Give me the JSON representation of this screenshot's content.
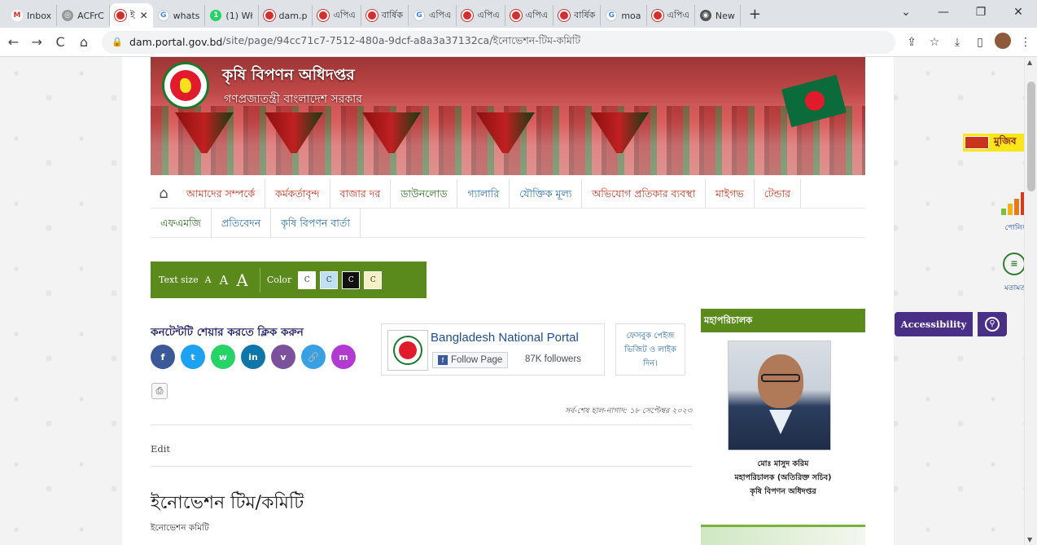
{
  "browser": {
    "tabs": [
      {
        "label": "Inbox",
        "icon": "gmail-icon"
      },
      {
        "label": "ACFrC",
        "icon": "globe-icon"
      },
      {
        "label": "ই",
        "icon": "dam-icon",
        "active": true
      },
      {
        "label": "whats",
        "icon": "google-icon"
      },
      {
        "label": "(1) Wł",
        "icon": "whatsapp-icon"
      },
      {
        "label": "dam.p",
        "icon": "dam-icon"
      },
      {
        "label": "এপিএ",
        "icon": "dam-icon"
      },
      {
        "label": "বার্ষিক",
        "icon": "dam-icon"
      },
      {
        "label": "এপিএ",
        "icon": "google-icon"
      },
      {
        "label": "এপিএ",
        "icon": "dam-icon"
      },
      {
        "label": "এপিএ",
        "icon": "dam-icon"
      },
      {
        "label": "বার্ষিক",
        "icon": "dam-icon"
      },
      {
        "label": "moa",
        "icon": "google-icon"
      },
      {
        "label": "এপিএ",
        "icon": "dam-icon"
      },
      {
        "label": "New",
        "icon": "chrome-icon"
      }
    ],
    "url_host": "dam.portal.gov.bd",
    "url_path": "/site/page/94cc71c7-7512-480a-9dcf-a8a3a37132ca/ইনোভেশন-টিম-কমিটি"
  },
  "header": {
    "title": "কৃষি বিপণন অধিদপ্তর",
    "subtitle": "গণপ্রজাতন্ত্রী বাংলাদেশ সরকার"
  },
  "menu": {
    "row1": [
      {
        "label": "আমাদের সম্পর্কে",
        "color": "red"
      },
      {
        "label": "কর্মকর্তাবৃন্দ",
        "color": "red"
      },
      {
        "label": "বাজার দর",
        "color": "red"
      },
      {
        "label": "ডাউনলোড",
        "color": "green"
      },
      {
        "label": "গ্যালারি",
        "color": "blue"
      },
      {
        "label": "যৌক্তিক মূল্য",
        "color": "blue"
      },
      {
        "label": "অভিযোগ প্রতিকার ব্যবস্থা",
        "color": "red"
      },
      {
        "label": "মাইগভ",
        "color": "red"
      },
      {
        "label": "টেন্ডার",
        "color": "red"
      }
    ],
    "row2": [
      {
        "label": "এফএমজি",
        "color": "green"
      },
      {
        "label": "প্রতিবেদন",
        "color": "blue"
      },
      {
        "label": "কৃষি বিপণন বার্তা",
        "color": "blue"
      }
    ]
  },
  "accessibility_bar": {
    "text_size_label": "Text size",
    "sizes": [
      "A",
      "A",
      "A"
    ],
    "color_label": "Color",
    "colors": [
      {
        "label": "C",
        "bg": "#ffffff",
        "fg": "#333333"
      },
      {
        "label": "C",
        "bg": "#bfe0f3",
        "fg": "#333333"
      },
      {
        "label": "C",
        "bg": "#111111",
        "fg": "#ffffff"
      },
      {
        "label": "C",
        "bg": "#f4f1c9",
        "fg": "#333333"
      }
    ]
  },
  "share": {
    "title": "কনটেন্টটি শেয়ার করতে ক্লিক করুন",
    "buttons": [
      {
        "name": "facebook",
        "glyph": "f",
        "color": "#3b5998"
      },
      {
        "name": "twitter",
        "glyph": "t",
        "color": "#1da1f2"
      },
      {
        "name": "whatsapp",
        "glyph": "w",
        "color": "#25d366"
      },
      {
        "name": "linkedin",
        "glyph": "in",
        "color": "#0e76a8"
      },
      {
        "name": "viber",
        "glyph": "v",
        "color": "#7b519d"
      },
      {
        "name": "link",
        "glyph": "🔗",
        "color": "#3aa0e4"
      },
      {
        "name": "messenger",
        "glyph": "m",
        "color": "#b23ad3"
      }
    ]
  },
  "facebook_card": {
    "page_name": "Bangladesh National Portal",
    "follow_label": "Follow Page",
    "followers": "87K followers"
  },
  "facebook_visit": {
    "line1": "ফেসবুক পেইজ",
    "line2": "ভিজিট ও লাইক",
    "line3": "দিন।"
  },
  "content": {
    "last_updated": "সর্ব-শেষ হাল-নাগাদ: ১৮ সেপ্টেম্বর ২০২৩",
    "edit_label": "Edit",
    "title": "ইনোভেশন টিম/কমিটি",
    "subtitle": "ইনোভেশন কমিটি"
  },
  "director_general": {
    "heading": "মহাপরিচালক",
    "name": "মোঃ মাসুদ করিম",
    "designation": "মহাপরিচালক (অতিরিক্ত সচিব)",
    "office": "কৃষি বিপণন অধিদপ্তর"
  },
  "floating": {
    "mujib_label": "মুজিব",
    "polling_label": "পোলিং",
    "opinion_label": "মতামত",
    "accessibility_label": "Accessibility"
  }
}
